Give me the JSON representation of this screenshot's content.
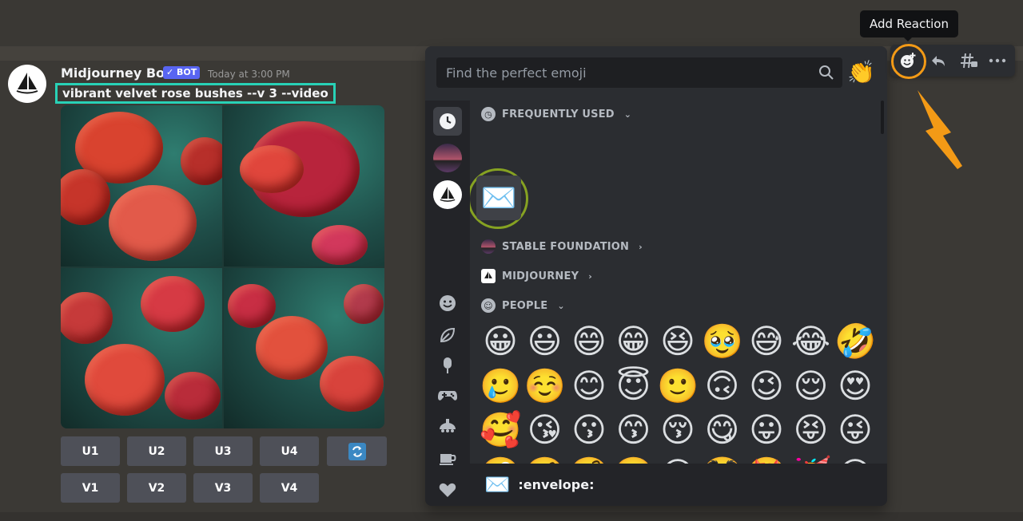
{
  "message": {
    "username": "Midjourney Bot",
    "bot_badge": "✓ BOT",
    "timestamp": "Today at 3:00 PM",
    "prompt": "vibrant velvet rose bushes --v 3 --video"
  },
  "buttons": {
    "upscale": [
      "U1",
      "U2",
      "U3",
      "U4"
    ],
    "variation": [
      "V1",
      "V2",
      "V3",
      "V4"
    ],
    "reroll_icon": "refresh-icon"
  },
  "picker": {
    "search_placeholder": "Find the perfect emoji",
    "clap_emoji": "👏",
    "sections": {
      "frequently_used": "FREQUENTLY USED",
      "stable_foundation": "STABLE FOUNDATION",
      "midjourney": "MIDJOURNEY",
      "people": "PEOPLE"
    },
    "frequent_emoji": "✉️",
    "people_emojis": [
      [
        "😀",
        "😃",
        "😄",
        "😁",
        "😆",
        "🥹",
        "😅",
        "😂",
        "🤣"
      ],
      [
        "🥲",
        "☺️",
        "😊",
        "😇",
        "🙂",
        "🙃",
        "😉",
        "😌",
        "😍"
      ],
      [
        "🥰",
        "😘",
        "😗",
        "😙",
        "😚",
        "😋",
        "😛",
        "😝",
        "😜"
      ],
      [
        "🤪",
        "🤨",
        "🧐",
        "🤓",
        "😎",
        "🥸",
        "🤩",
        "🥳",
        "😏"
      ],
      [
        "😒",
        "😞",
        "😔",
        "😟",
        "😕",
        "🙁",
        "☹️",
        "😣",
        "😖"
      ]
    ],
    "footer_emoji": "✉️",
    "footer_label": ":envelope:"
  },
  "tooltip": "Add Reaction",
  "colors": {
    "highlight_prompt": "#28d1b6",
    "highlight_envelope": "#86a222",
    "highlight_reaction": "#f39a16"
  }
}
